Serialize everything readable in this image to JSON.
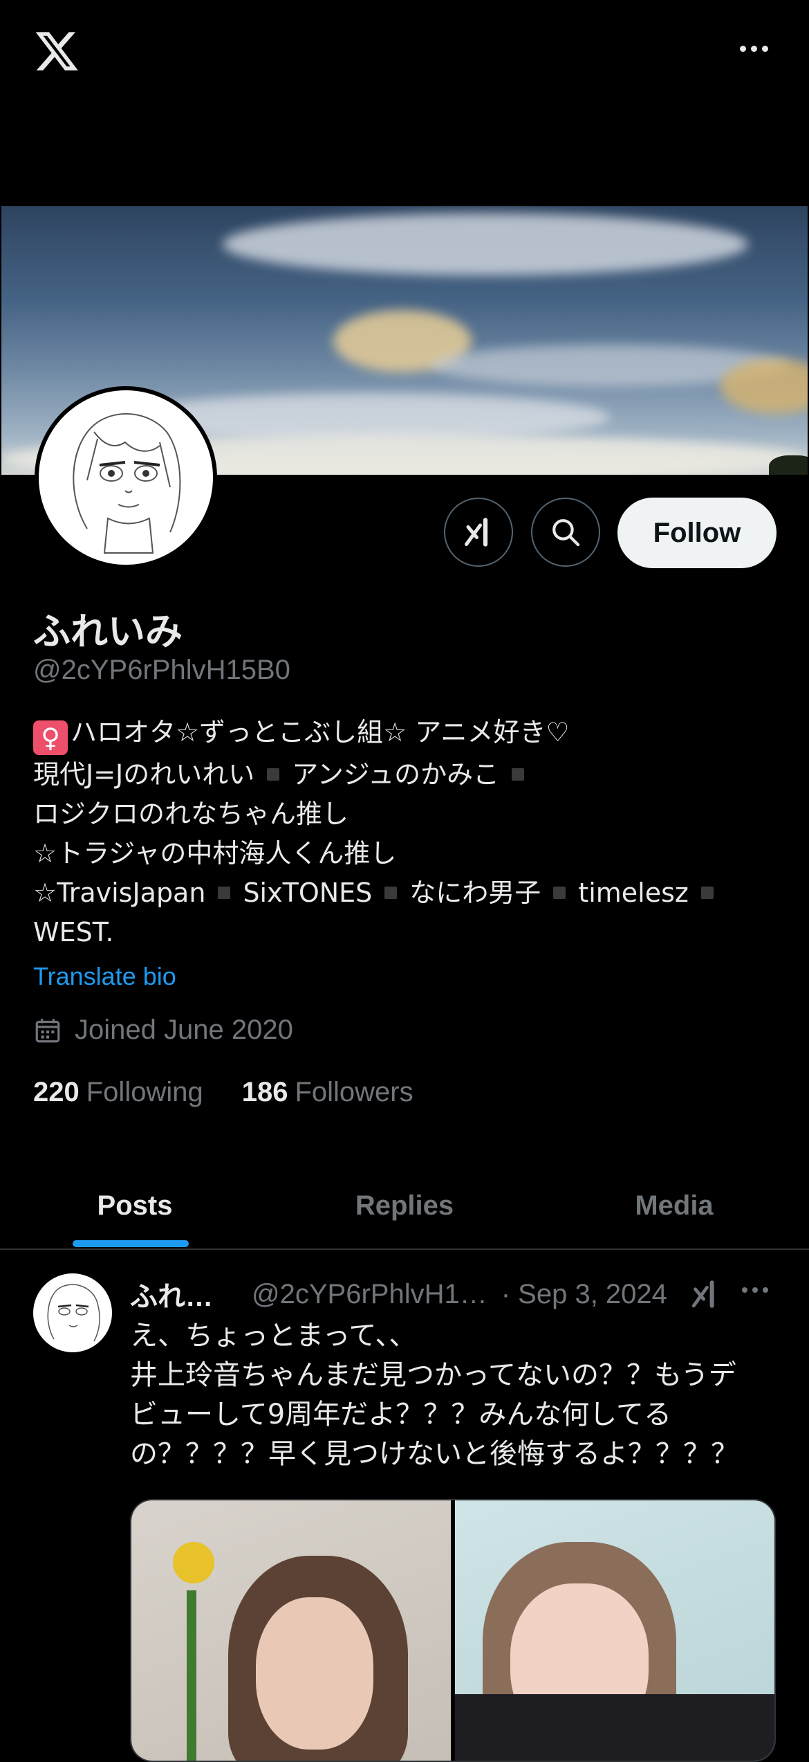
{
  "topbar": {
    "logo": "x-logo-icon",
    "more": "more-icon"
  },
  "profile": {
    "name": "ふれいみ",
    "handle": "@2cYP6rPhlvH15B0",
    "follow_label": "Follow",
    "bio_lines": [
      "ハロオタ☆ずっとこぶし組☆ アニメ好き♡",
      "現代J=Jのれいれい",
      "アンジュのかみこ",
      "ロジクロのれなちゃん推し",
      "☆トラジャの中村海人くん推し",
      "☆TravisJapan",
      "SixTONES",
      "なにわ男子",
      "timelesz",
      "WEST."
    ],
    "bio_emoji": "♀",
    "translate_label": "Translate bio",
    "joined": "Joined June 2020",
    "following_count": "220",
    "following_label": "Following",
    "followers_count": "186",
    "followers_label": "Followers"
  },
  "tabs": [
    {
      "label": "Posts",
      "active": true
    },
    {
      "label": "Replies",
      "active": false
    },
    {
      "label": "Media",
      "active": false
    }
  ],
  "post": {
    "name": "ふれ…",
    "handle": "@2cYP6rPhlvH1…",
    "date": "· Sep 3, 2024",
    "lines": [
      "え、ちょっとまって、、",
      "井上玲音ちゃんまだ見つかってないの？？もうデ",
      "ビューして9周年だよ？？？みんな何してる",
      "の？？？？早く見つけないと後悔するよ？？？？"
    ]
  },
  "colors": {
    "accent": "#1d9bf0",
    "background": "#000000",
    "muted": "#71767b"
  }
}
